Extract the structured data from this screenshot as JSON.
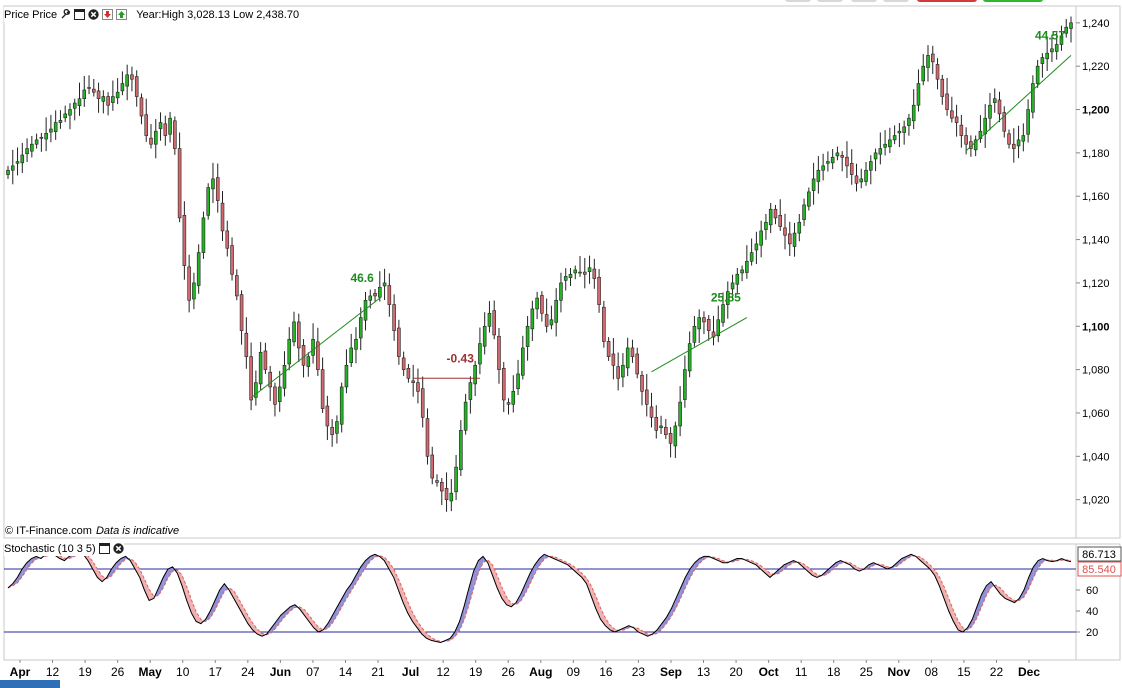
{
  "price_header": {
    "title": "Price Price",
    "stats": "Year:High 3,028.13 Low 2,438.70"
  },
  "stoch_header": {
    "title": "Stochastic (10 3 5)"
  },
  "copyright": {
    "owner": "© IT-Finance.com",
    "disclaimer": "Data is indicative"
  },
  "icons": {
    "properties": "wrench-icon",
    "maximize": "window-icon",
    "close": "close-circle-icon",
    "move_down": "red-down-arrow-icon",
    "move_up": "green-up-arrow-icon"
  },
  "colors": {
    "up_candle": "#22b422",
    "down_candle": "#d2696e",
    "up_trend": "#1e8c1e",
    "down_trend": "#a03030",
    "stoch_k_line": "#000000",
    "stoch_d_line": "#e06060",
    "fill_k_above": "#9090d8",
    "fill_k_below": "#f0b0b0",
    "level_lines": "#2a2aa0",
    "k_value_label": "#000000",
    "d_value_label": "#e05050"
  },
  "chart_data": [
    {
      "type": "candlestick",
      "title": "Price Price",
      "y_ticks": [
        "1,020",
        "1,040",
        "1,060",
        "1,080",
        "1,100",
        "1,120",
        "1,140",
        "1,160",
        "1,180",
        "1,200",
        "1,220",
        "1,240"
      ],
      "y_tick_values": [
        1020,
        1040,
        1060,
        1080,
        1100,
        1120,
        1140,
        1160,
        1180,
        1200,
        1220,
        1240
      ],
      "y_bold_ticks": [
        "1,100",
        "1,200"
      ],
      "ylim": [
        1006,
        1245
      ],
      "x_ticks": [
        "Apr",
        "12",
        "19",
        "26",
        "May",
        "10",
        "17",
        "24",
        "Jun",
        "07",
        "14",
        "21",
        "Jul",
        "12",
        "19",
        "26",
        "Aug",
        "09",
        "16",
        "23",
        "Sep",
        "13",
        "20",
        "Oct",
        "11",
        "18",
        "25",
        "Nov",
        "08",
        "15",
        "22",
        "Dec"
      ],
      "x_bold_ticks": [
        "Apr",
        "May",
        "Jun",
        "Jul",
        "Aug",
        "Sep",
        "Oct",
        "Nov",
        "Dec"
      ],
      "trend_annotations": [
        {
          "label": "46.6",
          "start": 1067,
          "end": 1113,
          "direction": "up"
        },
        {
          "label": "-0.43",
          "start": 1076,
          "end": 1076,
          "direction": "down"
        },
        {
          "label": "25.85",
          "start": 1079,
          "end": 1104,
          "direction": "up"
        },
        {
          "label": "44.57",
          "start": 1181,
          "end": 1225,
          "direction": "up"
        }
      ],
      "series_close": [
        1172,
        1174,
        1176,
        1179,
        1182,
        1184,
        1186,
        1187,
        1189,
        1191,
        1194,
        1195,
        1198,
        1200,
        1203,
        1205,
        1209,
        1210,
        1208,
        1205,
        1206,
        1202,
        1206,
        1208,
        1212,
        1216,
        1214,
        1206,
        1197,
        1188,
        1184,
        1190,
        1194,
        1188,
        1196,
        1182,
        1150,
        1128,
        1112,
        1120,
        1134,
        1150,
        1164,
        1168,
        1158,
        1144,
        1136,
        1124,
        1114,
        1098,
        1086,
        1066,
        1074,
        1088,
        1080,
        1072,
        1064,
        1072,
        1082,
        1094,
        1102,
        1090,
        1082,
        1086,
        1094,
        1080,
        1062,
        1054,
        1050,
        1056,
        1072,
        1082,
        1090,
        1094,
        1104,
        1112,
        1114,
        1114,
        1118,
        1120,
        1110,
        1098,
        1086,
        1080,
        1076,
        1074,
        1070,
        1058,
        1040,
        1030,
        1028,
        1024,
        1020,
        1023,
        1035,
        1052,
        1065,
        1074,
        1082,
        1092,
        1100,
        1106,
        1096,
        1080,
        1066,
        1064,
        1070,
        1078,
        1090,
        1100,
        1108,
        1113,
        1106,
        1100,
        1103,
        1112,
        1120,
        1123,
        1124,
        1126,
        1125,
        1124,
        1127,
        1122,
        1110,
        1093,
        1086,
        1082,
        1076,
        1082,
        1090,
        1086,
        1078,
        1070,
        1064,
        1058,
        1052,
        1054,
        1050,
        1046,
        1054,
        1065,
        1080,
        1092,
        1100,
        1104,
        1102,
        1098,
        1095,
        1103,
        1110,
        1116,
        1120,
        1124,
        1126,
        1130,
        1134,
        1138,
        1144,
        1148,
        1154,
        1150,
        1146,
        1142,
        1138,
        1143,
        1148,
        1156,
        1162,
        1168,
        1172,
        1174,
        1176,
        1178,
        1180,
        1178,
        1174,
        1170,
        1166,
        1168,
        1172,
        1176,
        1180,
        1182,
        1184,
        1186,
        1188,
        1190,
        1192,
        1196,
        1202,
        1212,
        1220,
        1225,
        1222,
        1214,
        1206,
        1200,
        1196,
        1194,
        1188,
        1184,
        1182,
        1186,
        1190,
        1196,
        1202,
        1205,
        1198,
        1190,
        1184,
        1182,
        1186,
        1188,
        1200,
        1212,
        1220,
        1224,
        1226,
        1228,
        1230,
        1234,
        1238,
        1240
      ]
    },
    {
      "type": "line",
      "title": "Stochastic (10 3 5)",
      "y_ticks": [
        "20",
        "40",
        "60"
      ],
      "y_tick_values": [
        20,
        40,
        60
      ],
      "ylim": [
        0,
        100
      ],
      "levels": [
        20,
        80
      ],
      "current_k_label": "86.713",
      "current_d_label": "85.540",
      "k_series": [
        62,
        66,
        72,
        80,
        86,
        90,
        92,
        90,
        94,
        95,
        93,
        90,
        88,
        92,
        95,
        96,
        94,
        88,
        80,
        72,
        68,
        72,
        80,
        86,
        90,
        92,
        88,
        80,
        72,
        60,
        50,
        52,
        62,
        72,
        80,
        82,
        76,
        64,
        50,
        38,
        30,
        28,
        32,
        40,
        50,
        60,
        66,
        60,
        52,
        44,
        36,
        28,
        22,
        18,
        16,
        18,
        24,
        30,
        36,
        40,
        44,
        46,
        42,
        36,
        30,
        24,
        20,
        22,
        28,
        36,
        44,
        52,
        60,
        66,
        74,
        82,
        88,
        92,
        94,
        92,
        88,
        80,
        72,
        60,
        48,
        38,
        30,
        24,
        18,
        14,
        12,
        11,
        10,
        12,
        14,
        20,
        30,
        45,
        62,
        78,
        88,
        92,
        86,
        74,
        62,
        52,
        46,
        44,
        48,
        56,
        66,
        76,
        84,
        90,
        94,
        92,
        90,
        88,
        86,
        84,
        80,
        76,
        72,
        66,
        54,
        42,
        32,
        26,
        22,
        20,
        22,
        24,
        26,
        24,
        20,
        18,
        16,
        18,
        22,
        28,
        34,
        42,
        52,
        62,
        72,
        80,
        86,
        90,
        92,
        92,
        90,
        88,
        86,
        86,
        88,
        90,
        90,
        88,
        86,
        84,
        80,
        76,
        72,
        76,
        80,
        84,
        86,
        88,
        86,
        82,
        78,
        74,
        72,
        74,
        78,
        82,
        86,
        88,
        86,
        84,
        80,
        78,
        80,
        84,
        86,
        84,
        82,
        80,
        82,
        86,
        90,
        92,
        94,
        92,
        88,
        84,
        80,
        74,
        64,
        52,
        40,
        30,
        22,
        20,
        24,
        32,
        44,
        56,
        64,
        68,
        62,
        56,
        52,
        50,
        48,
        52,
        60,
        72,
        82,
        88,
        90,
        88,
        87,
        88,
        90,
        88,
        87
      ]
    }
  ]
}
